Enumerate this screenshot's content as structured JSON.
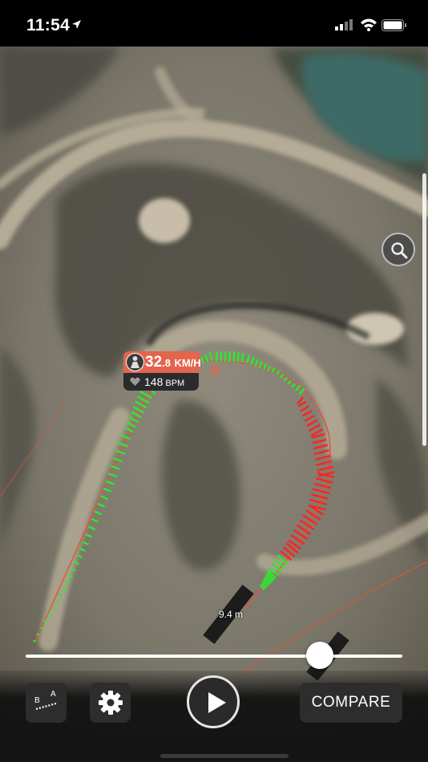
{
  "status_bar": {
    "time": "11:54"
  },
  "map": {
    "speed_tip": {
      "speed_int": "32",
      "speed_dec": ".8",
      "speed_unit": "KM/H",
      "heart_rate": "148",
      "heart_unit": "BPM"
    },
    "distance_label": "9.4 m",
    "colors": {
      "fast": "#2ee82e",
      "slow": "#ff2222",
      "route": "#e0553a",
      "tip_bg": "#e2654d"
    }
  },
  "controls": {
    "timeline_progress": 0.78,
    "ab_icon": {
      "a": "A",
      "b": "B"
    },
    "compare_label": "COMPARE"
  }
}
